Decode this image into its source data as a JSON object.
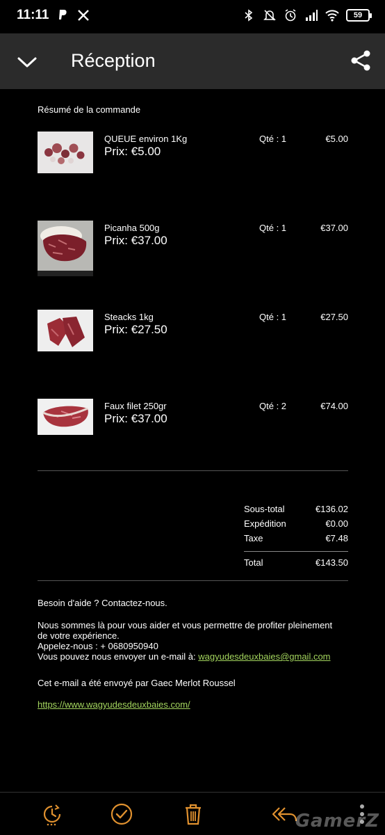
{
  "status": {
    "time": "11:11",
    "battery": "59",
    "left_icons": [
      "paypal-icon",
      "x-icon"
    ],
    "right_icons": [
      "bluetooth-icon",
      "mute-icon",
      "alarm-icon",
      "signal-icon",
      "wifi-icon"
    ]
  },
  "app_bar": {
    "title": "Réception"
  },
  "order": {
    "section_title": "Résumé de la commande",
    "items": [
      {
        "name": "QUEUE environ 1Kg",
        "price": "Prix: €5.00",
        "qty": "Qté : 1",
        "total": "€5.00"
      },
      {
        "name": "Picanha 500g",
        "price": "Prix: €37.00",
        "qty": "Qté : 1",
        "total": "€37.00"
      },
      {
        "name": "Steacks 1kg",
        "price": "Prix: €27.50",
        "qty": "Qté : 1",
        "total": "€27.50"
      },
      {
        "name": "Faux filet 250gr",
        "price": "Prix: €37.00",
        "qty": "Qté : 2",
        "total": "€74.00"
      }
    ]
  },
  "totals": {
    "subtotal_label": "Sous-total",
    "subtotal_value": "€136.02",
    "shipping_label": "Expédition",
    "shipping_value": "€0.00",
    "tax_label": "Taxe",
    "tax_value": "€7.48",
    "total_label": "Total",
    "total_value": "€143.50"
  },
  "help": {
    "heading": "Besoin d'aide ? Contactez-nous.",
    "line1": "Nous sommes là pour vous aider et vous permettre de profiter pleinement de votre expérience.",
    "phone": "Appelez-nous : + 0680950940",
    "email_prefix": "Vous pouvez nous envoyer un e-mail à: ",
    "email": "wagyudesdeuxbaies@gmail.com",
    "sent_by": "Cet e-mail a été envoyé par Gaec Merlot Roussel",
    "website": "https://www.wagyudesdeuxbaies.com/"
  },
  "bottom_bar": {
    "icons": [
      "snooze-icon",
      "check-circle-icon",
      "trash-icon",
      "reply-all-icon",
      "more-icon"
    ],
    "watermark": "GamerZ",
    "accent": "#e0912f"
  }
}
